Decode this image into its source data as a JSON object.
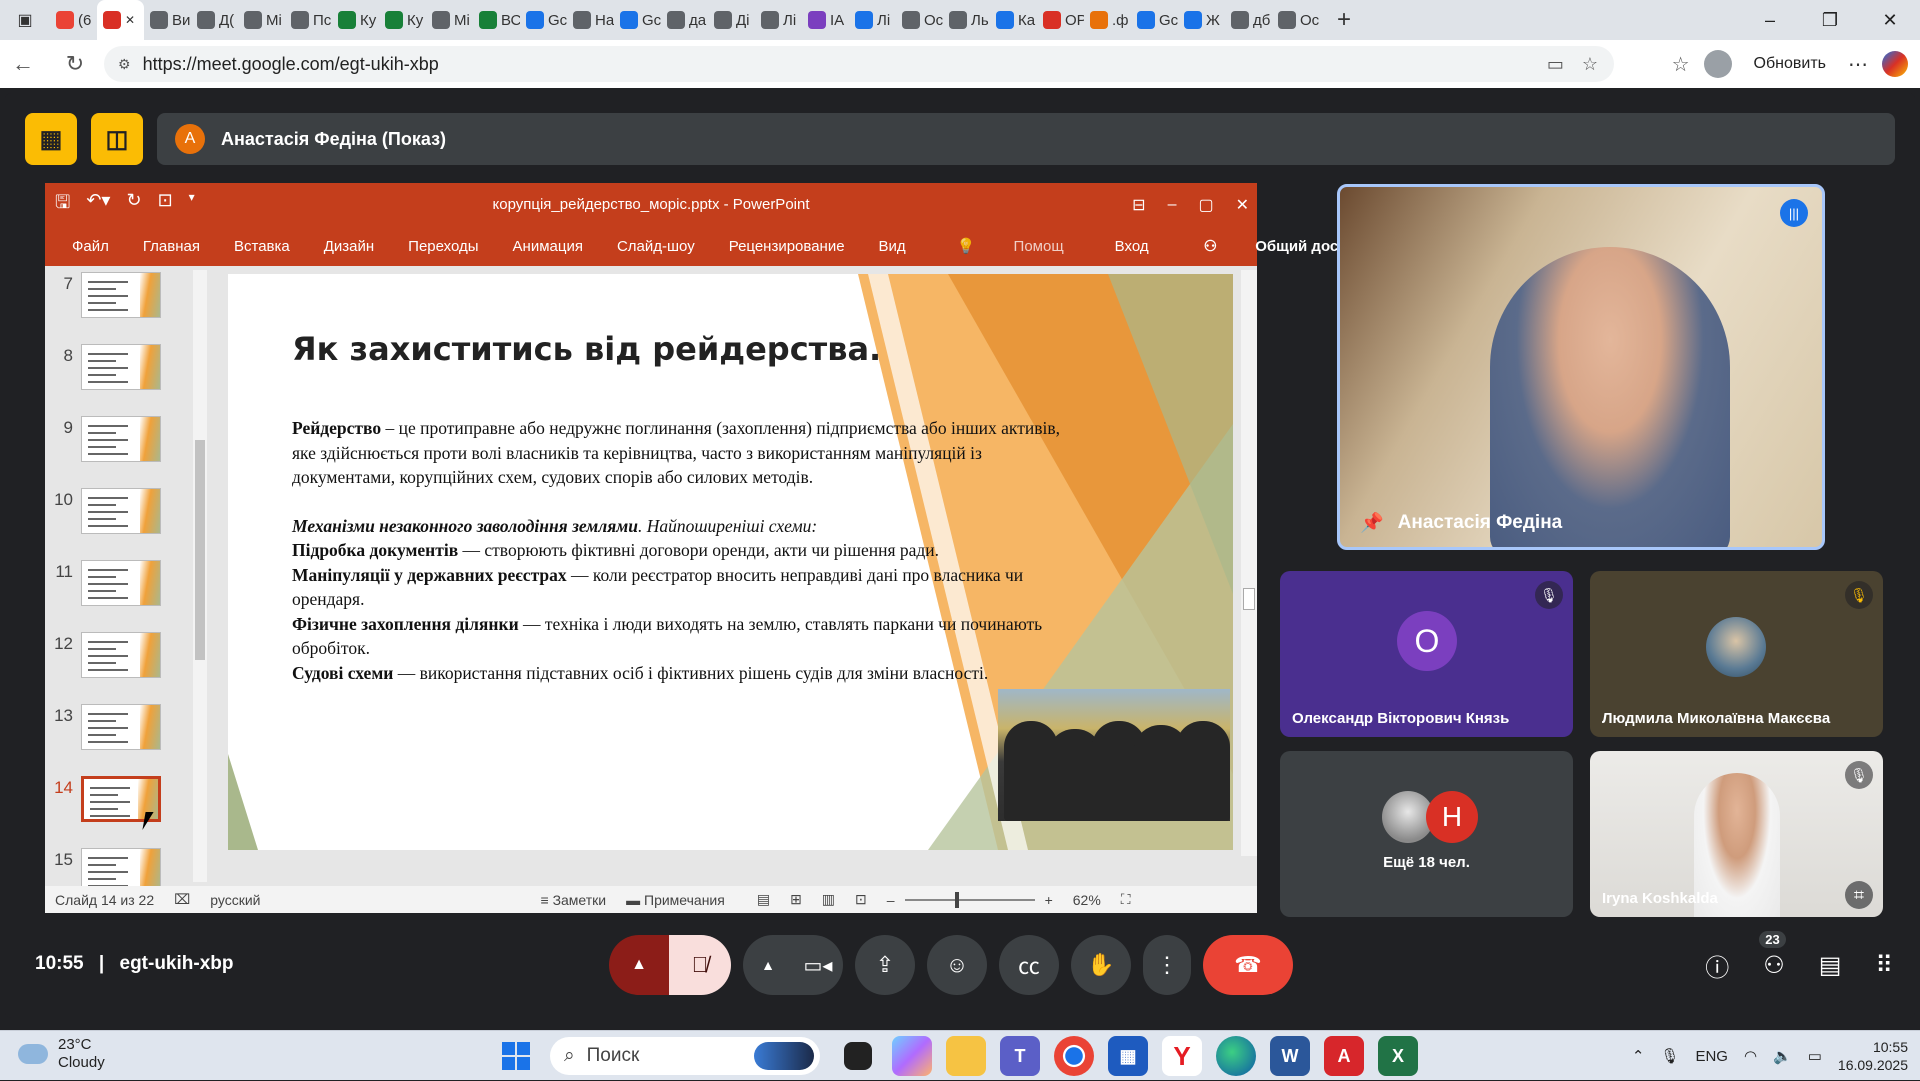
{
  "browser": {
    "tabs": [
      {
        "label": "(6",
        "color": "#ea4335"
      },
      {
        "label": "",
        "color": "#d93025",
        "active": true
      },
      {
        "label": "Ви",
        "color": "#5f6368"
      },
      {
        "label": "Д(",
        "color": "#5f6368"
      },
      {
        "label": "Мі",
        "color": "#5f6368"
      },
      {
        "label": "Пс",
        "color": "#5f6368"
      },
      {
        "label": "Ку",
        "color": "#188038"
      },
      {
        "label": "Ку",
        "color": "#188038"
      },
      {
        "label": "Мі",
        "color": "#5f6368"
      },
      {
        "label": "ВС",
        "color": "#188038"
      },
      {
        "label": "Gc",
        "color": "#1a73e8"
      },
      {
        "label": "На",
        "color": "#5f6368"
      },
      {
        "label": "Gc",
        "color": "#1a73e8"
      },
      {
        "label": "да",
        "color": "#5f6368"
      },
      {
        "label": "Ді",
        "color": "#5f6368"
      },
      {
        "label": "Лі",
        "color": "#5f6368"
      },
      {
        "label": "IA",
        "color": "#7b3fbf"
      },
      {
        "label": "Лі",
        "color": "#1a73e8"
      },
      {
        "label": "Ос",
        "color": "#5f6368"
      },
      {
        "label": "Ль",
        "color": "#5f6368"
      },
      {
        "label": "Ка",
        "color": "#1a73e8"
      },
      {
        "label": "ОР",
        "color": "#d93025"
      },
      {
        "label": ".ф",
        "color": "#e8710a"
      },
      {
        "label": "Gc",
        "color": "#1a73e8"
      },
      {
        "label": "Ж",
        "color": "#1a73e8"
      },
      {
        "label": "дб",
        "color": "#5f6368"
      },
      {
        "label": "Ос",
        "color": "#5f6368"
      }
    ],
    "url": "https://meet.google.com/egt-ukih-xbp",
    "update_label": "Обновить"
  },
  "meet": {
    "presenter_initial": "А",
    "presenter_banner": "Анастасія Федіна (Показ)",
    "time": "10:55",
    "meeting_code": "egt-ukih-xbp",
    "participant_count": "23",
    "participants": {
      "main": "Анастасія Федіна",
      "o_initial": "О",
      "o_name": "Олександр Вікторович Князь",
      "l_name": "Людмила Миколаївна Макєєва",
      "more_initial": "Н",
      "more_label": "Ещё 18 чел.",
      "i_name": "Iryna Koshkalda"
    }
  },
  "ppt": {
    "doc_title": "корупція_рейдерство_моріс.pptx - PowerPoint",
    "ribbon": [
      "Файл",
      "Главная",
      "Вставка",
      "Дизайн",
      "Переходы",
      "Анимация",
      "Слайд-шоу",
      "Рецензирование",
      "Вид",
      "Помощ"
    ],
    "login": "Вход",
    "share": "Общий доступ",
    "thumb_numbers": [
      "7",
      "8",
      "9",
      "10",
      "11",
      "12",
      "13",
      "14",
      "15"
    ],
    "active_slide": "14",
    "status": {
      "slide_info": "Слайд 14 из 22",
      "language": "русский",
      "notes": "Заметки",
      "comments": "Примечания",
      "zoom": "62%"
    },
    "slide": {
      "title": "Як захиститись від рейдерства.",
      "p1_bold": "Рейдерство",
      "p1_text": " – це протиправне або недружнє поглинання (захоплення) підприємства або інших активів, яке здійснюється проти волі власників та керівництва, часто з використанням маніпуляцій із документами, корупційних схем, судових спорів або силових методів.",
      "p2_bold": "Механізми незаконного заволодіння землями",
      "p2_text": ". Найпоширеніші схеми:",
      "b1_bold": "Підробка документів",
      "b1_text": " — створюють фіктивні договори оренди, акти чи рішення ради.",
      "b2_bold": "Маніпуляції у державних реєстрах",
      "b2_text": " — коли реєстратор вносить неправдиві дані про власника чи орендаря.",
      "b3_bold": "Фізичне захоплення ділянки",
      "b3_text": " — техніка і люди виходять на землю, ставлять паркани чи починають обробіток.",
      "b4_bold": "Судові схеми",
      "b4_text": " — використання підставних осіб і фіктивних рішень судів для зміни власності."
    }
  },
  "taskbar": {
    "temp": "23°C",
    "weather": "Cloudy",
    "search": "Поиск",
    "lang": "ENG",
    "time": "10:55",
    "date": "16.09.2025"
  },
  "colors": {
    "ppt_red": "#c43e1c",
    "meet_bg": "#202124",
    "yellow": "#fbbc04",
    "end_call": "#ea4335"
  }
}
